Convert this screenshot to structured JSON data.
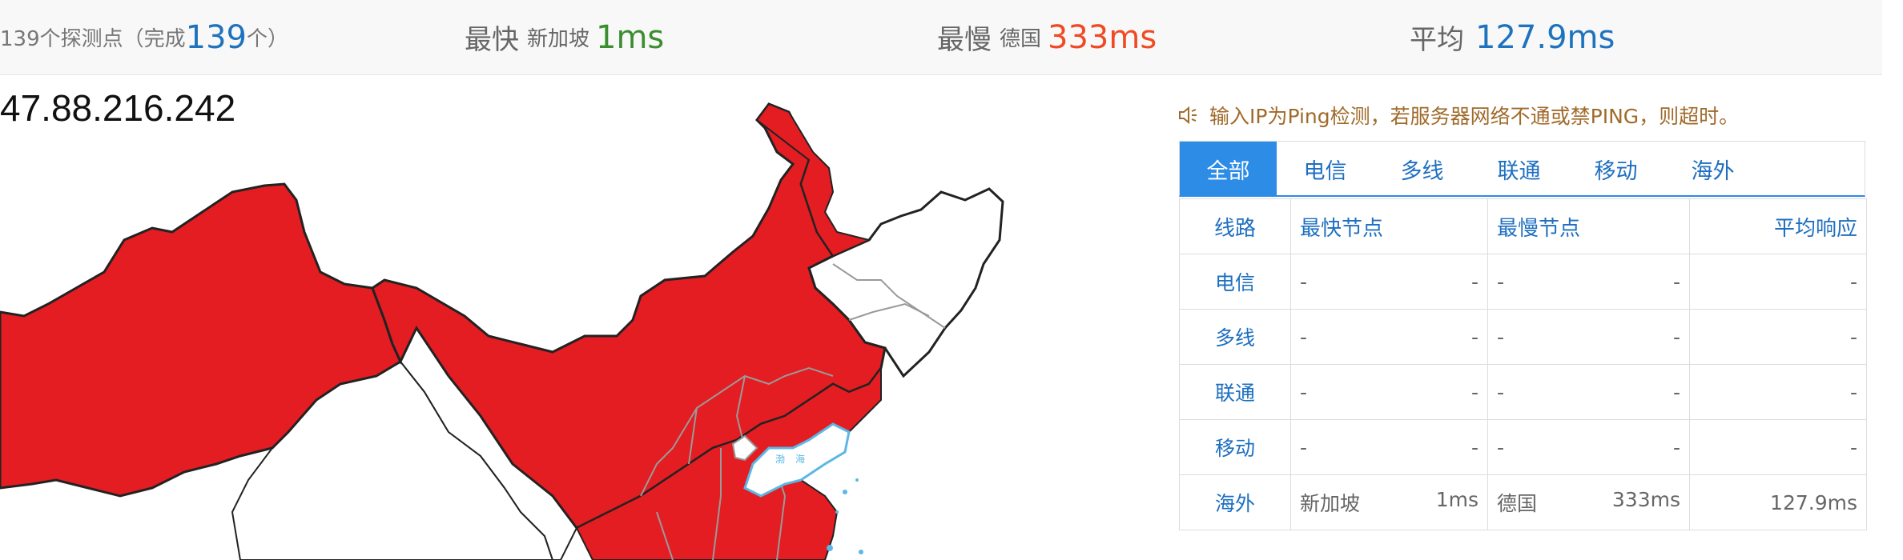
{
  "summary": {
    "count_prefix": "139个探测点（完成",
    "count_done": "139",
    "count_suffix": "个）",
    "fastest_label": "最快",
    "fastest_location": "新加坡",
    "fastest_value": "1ms",
    "slowest_label": "最慢",
    "slowest_location": "德国",
    "slowest_value": "333ms",
    "average_label": "平均",
    "average_value": "127.9ms"
  },
  "ip_address": "47.88.216.242",
  "map": {
    "name": "China",
    "colors": {
      "reached": "#e31d22",
      "unreached": "#ffffff",
      "border": "#222222",
      "sea": "#5bb7e6"
    },
    "sea_labels": [
      "渤",
      "海"
    ]
  },
  "notice": "输入IP为Ping检测，若服务器网络不通或禁PING，则超时。",
  "tabs": [
    {
      "label": "全部",
      "active": true
    },
    {
      "label": "电信",
      "active": false
    },
    {
      "label": "多线",
      "active": false
    },
    {
      "label": "联通",
      "active": false
    },
    {
      "label": "移动",
      "active": false
    },
    {
      "label": "海外",
      "active": false
    }
  ],
  "table": {
    "headers": {
      "line": "线路",
      "fastest": "最快节点",
      "slowest": "最慢节点",
      "average": "平均响应"
    },
    "rows": [
      {
        "line": "电信",
        "fast_node": "-",
        "fast_ms": "-",
        "slow_node": "-",
        "slow_ms": "-",
        "avg": "-"
      },
      {
        "line": "多线",
        "fast_node": "-",
        "fast_ms": "-",
        "slow_node": "-",
        "slow_ms": "-",
        "avg": "-"
      },
      {
        "line": "联通",
        "fast_node": "-",
        "fast_ms": "-",
        "slow_node": "-",
        "slow_ms": "-",
        "avg": "-"
      },
      {
        "line": "移动",
        "fast_node": "-",
        "fast_ms": "-",
        "slow_node": "-",
        "slow_ms": "-",
        "avg": "-"
      },
      {
        "line": "海外",
        "fast_node": "新加坡",
        "fast_ms": "1ms",
        "slow_node": "德国",
        "slow_ms": "333ms",
        "avg": "127.9ms"
      }
    ]
  },
  "colors": {
    "accent": "#2d8ce6",
    "link": "#1e6fc0",
    "fast": "#3b8e2f",
    "slow": "#f04a23",
    "notice": "#a06a2a"
  }
}
